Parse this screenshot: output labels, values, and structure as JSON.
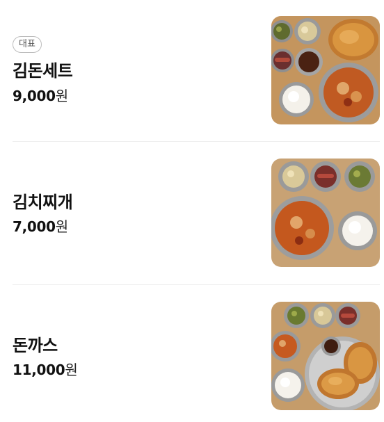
{
  "menu": {
    "items": [
      {
        "badge": "대표",
        "name": "김돈세트",
        "price_amount": "9,000",
        "price_unit": "원",
        "photo_icon": "food-photo-icon"
      },
      {
        "badge": "",
        "name": "김치찌개",
        "price_amount": "7,000",
        "price_unit": "원",
        "photo_icon": "food-photo-icon"
      },
      {
        "badge": "",
        "name": "돈까스",
        "price_amount": "11,000",
        "price_unit": "원",
        "photo_icon": "food-photo-icon"
      }
    ]
  },
  "colors": {
    "text": "#111111",
    "badge_border": "#bdbdbd",
    "divider": "#eeeeee",
    "table_wood": "#c89a63"
  }
}
